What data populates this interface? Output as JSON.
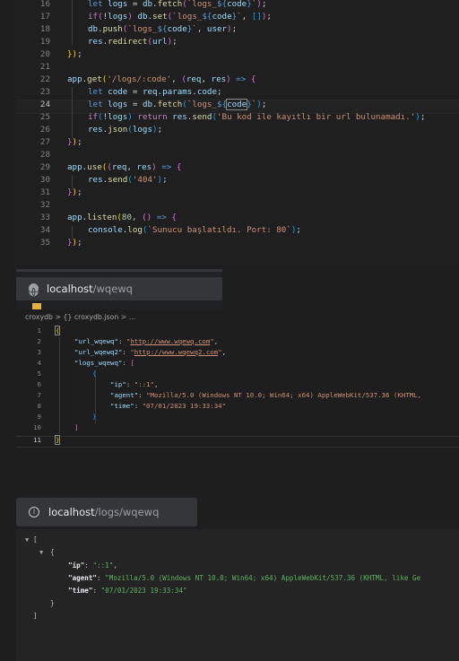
{
  "editor1": {
    "lines": [
      {
        "n": "16"
      },
      {
        "n": "17"
      },
      {
        "n": "18"
      },
      {
        "n": "19"
      },
      {
        "n": "20"
      },
      {
        "n": "21"
      },
      {
        "n": "22"
      },
      {
        "n": "23"
      },
      {
        "n": "24"
      },
      {
        "n": "25"
      },
      {
        "n": "26"
      },
      {
        "n": "27"
      },
      {
        "n": "28"
      },
      {
        "n": "29"
      },
      {
        "n": "30"
      },
      {
        "n": "31"
      },
      {
        "n": "32"
      },
      {
        "n": "33"
      },
      {
        "n": "34"
      },
      {
        "n": "35"
      }
    ]
  },
  "browser1": {
    "host": "localhost",
    "path": "/wqewq"
  },
  "editor2": {
    "breadcrumb": "croxydb > {} croxydb.json > ...",
    "lines": [
      "1",
      "2",
      "3",
      "4",
      "5",
      "6",
      "7",
      "8",
      "9",
      "10",
      "11"
    ]
  },
  "browser2": {
    "host": "localhost",
    "path": "/logs/wqewq"
  },
  "json_view": {
    "ip_key": "\"ip\"",
    "ip_val": "\"::1\"",
    "agent_key": "\"agent\"",
    "agent_val": "\"Mozilla/5.0 (Windows NT 10.0; Win64; x64) AppleWebKit/537.36 (KHTML, like Ge",
    "time_key": "\"time\"",
    "time_val": "\"07/01/2023 19:33:34\""
  },
  "colors": {
    "editor_bg": "#1f1f1f",
    "browser_bar": "#35363a",
    "string": "#ce9178",
    "json_string": "#5db45f"
  }
}
